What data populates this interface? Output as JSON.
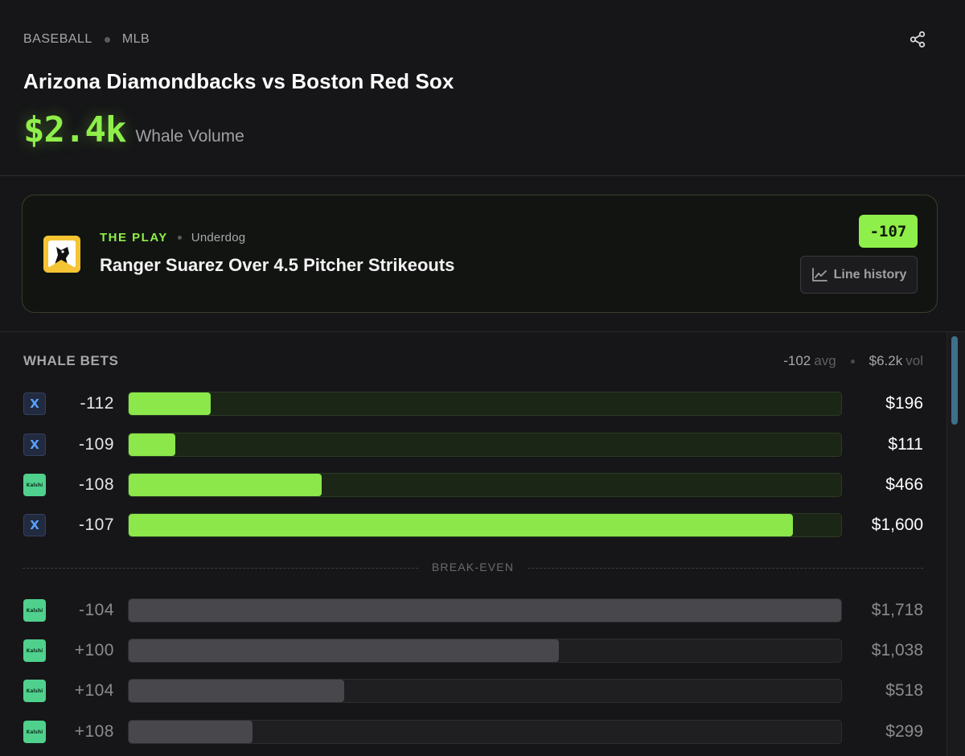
{
  "header": {
    "breadcrumb": [
      "BASEBALL",
      "MLB"
    ],
    "title": "Arizona Diamondbacks vs Boston Red Sox",
    "volume_amount": "$2.4k",
    "volume_label": "Whale Volume",
    "share_icon": "share-icon"
  },
  "play": {
    "kicker": "THE PLAY",
    "book": "Underdog",
    "title": "Ranger Suarez Over 4.5 Pitcher Strikeouts",
    "odds": "-107",
    "line_history_label": "Line history",
    "logo_icon": "underdog-logo"
  },
  "whale_bets": {
    "title": "WHALE BETS",
    "avg_value": "-102",
    "avg_unit": "avg",
    "vol_value": "$6.2k",
    "vol_unit": "vol",
    "break_even_label": "BREAK-EVEN",
    "rows": [
      {
        "source": "X",
        "odds": "-112",
        "amount": "$196",
        "fill": 0.115,
        "zone": "green"
      },
      {
        "source": "X",
        "odds": "-109",
        "amount": "$111",
        "fill": 0.065,
        "zone": "green"
      },
      {
        "source": "Kalshi",
        "odds": "-108",
        "amount": "$466",
        "fill": 0.271,
        "zone": "green"
      },
      {
        "source": "X",
        "odds": "-107",
        "amount": "$1,600",
        "fill": 0.932,
        "zone": "green"
      },
      {
        "source": "Kalshi",
        "odds": "-104",
        "amount": "$1,718",
        "fill": 1.0,
        "zone": "gray"
      },
      {
        "source": "Kalshi",
        "odds": "+100",
        "amount": "$1,038",
        "fill": 0.604,
        "zone": "gray"
      },
      {
        "source": "Kalshi",
        "odds": "+104",
        "amount": "$518",
        "fill": 0.302,
        "zone": "gray"
      },
      {
        "source": "Kalshi",
        "odds": "+108",
        "amount": "$299",
        "fill": 0.174,
        "zone": "gray"
      }
    ]
  },
  "colors": {
    "accent_green": "#8fef4a",
    "background": "#161618",
    "x_source": "#5aa0ff",
    "kalshi_source": "#4fd18d"
  }
}
